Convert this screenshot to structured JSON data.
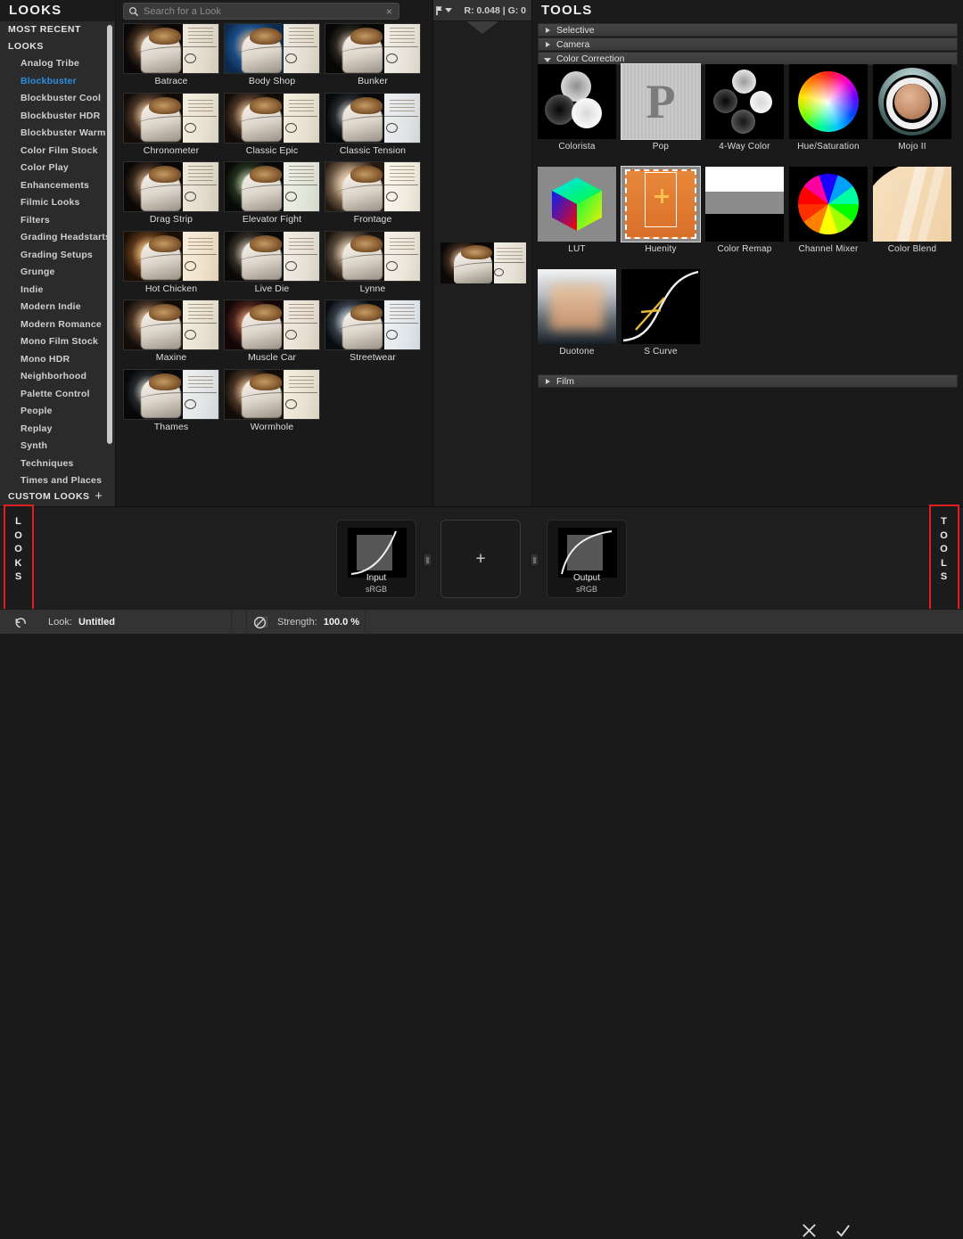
{
  "sidebar": {
    "title": "LOOKS",
    "groups": [
      {
        "label": "MOST RECENT"
      },
      {
        "label": "LOOKS"
      }
    ],
    "items": [
      {
        "label": "Analog Tribe",
        "active": false
      },
      {
        "label": "Blockbuster",
        "active": true
      },
      {
        "label": "Blockbuster Cool",
        "active": false
      },
      {
        "label": "Blockbuster HDR",
        "active": false
      },
      {
        "label": "Blockbuster Warm",
        "active": false
      },
      {
        "label": "Color Film Stock",
        "active": false
      },
      {
        "label": "Color Play",
        "active": false
      },
      {
        "label": "Enhancements",
        "active": false
      },
      {
        "label": "Filmic Looks",
        "active": false
      },
      {
        "label": "Filters",
        "active": false
      },
      {
        "label": "Grading Headstarts",
        "active": false
      },
      {
        "label": "Grading Setups",
        "active": false
      },
      {
        "label": "Grunge",
        "active": false
      },
      {
        "label": "Indie",
        "active": false
      },
      {
        "label": "Modern Indie",
        "active": false
      },
      {
        "label": "Modern Romance",
        "active": false
      },
      {
        "label": "Mono Film Stock",
        "active": false
      },
      {
        "label": "Mono HDR",
        "active": false
      },
      {
        "label": "Neighborhood",
        "active": false
      },
      {
        "label": "Palette Control",
        "active": false
      },
      {
        "label": "People",
        "active": false
      },
      {
        "label": "Replay",
        "active": false
      },
      {
        "label": "Synth",
        "active": false
      },
      {
        "label": "Techniques",
        "active": false
      },
      {
        "label": "Times and Places",
        "active": false
      }
    ],
    "custom_looks_label": "CUSTOM LOOKS",
    "custom_looks_add": "+"
  },
  "search": {
    "placeholder": "Search for a Look",
    "value": "",
    "clear_glyph": "×",
    "icon": "search-icon",
    "import_icon": "import-look-icon"
  },
  "looks": [
    {
      "name": "Batrace",
      "tone": "warm-dark"
    },
    {
      "name": "Body Shop",
      "tone": "blue"
    },
    {
      "name": "Bunker",
      "tone": "neutral-dark"
    },
    {
      "name": "Chronometer",
      "tone": "warm"
    },
    {
      "name": "Classic Epic",
      "tone": "warm"
    },
    {
      "name": "Classic Tension",
      "tone": "cool-dark"
    },
    {
      "name": "Drag Strip",
      "tone": "warm-dark"
    },
    {
      "name": "Elevator Fight",
      "tone": "green"
    },
    {
      "name": "Frontage",
      "tone": "bright"
    },
    {
      "name": "Hot Chicken",
      "tone": "hot"
    },
    {
      "name": "Live Die",
      "tone": "neutral"
    },
    {
      "name": "Lynne",
      "tone": "soft"
    },
    {
      "name": "Maxine",
      "tone": "warm"
    },
    {
      "name": "Muscle Car",
      "tone": "red"
    },
    {
      "name": "Streetwear",
      "tone": "cool"
    },
    {
      "name": "Thames",
      "tone": "cool-dark"
    },
    {
      "name": "Wormhole",
      "tone": "warm"
    }
  ],
  "viewer": {
    "readout": "R: 0.048 | G: 0",
    "flag_icon": "flag-icon",
    "dropdown_icon": "chevron-down-icon"
  },
  "tools": {
    "title": "TOOLS",
    "sections": [
      {
        "label": "Selective",
        "expanded": false
      },
      {
        "label": "Camera",
        "expanded": false
      },
      {
        "label": "Color Correction",
        "expanded": true
      }
    ],
    "footer_section": {
      "label": "Film",
      "expanded": false
    },
    "items": [
      {
        "label": "Colorista",
        "icon": "colorista-balls-icon",
        "selected": false
      },
      {
        "label": "Pop",
        "icon": "pop-p-icon",
        "selected": true
      },
      {
        "label": "4-Way Color",
        "icon": "four-way-color-icon",
        "selected": false
      },
      {
        "label": "Hue/Saturation",
        "icon": "hue-saturation-icon",
        "selected": false
      },
      {
        "label": "Mojo II",
        "icon": "mojo-ring-icon",
        "selected": false
      },
      {
        "label": "LUT",
        "icon": "lut-cube-icon",
        "selected": false
      },
      {
        "label": "Huenity",
        "icon": "huenity-crop-icon",
        "selected": true
      },
      {
        "label": "Color Remap",
        "icon": "color-remap-bars-icon",
        "selected": false
      },
      {
        "label": "Channel Mixer",
        "icon": "channel-mixer-wheel-icon",
        "selected": false
      },
      {
        "label": "Color Blend",
        "icon": "color-blend-icon",
        "selected": false
      },
      {
        "label": "Duotone",
        "icon": "duotone-gradient-icon",
        "selected": false
      },
      {
        "label": "S Curve",
        "icon": "s-curve-icon",
        "selected": false
      }
    ]
  },
  "nodes": [
    {
      "label": "Input",
      "sub": "sRGB",
      "type": "io"
    },
    {
      "label": "+",
      "sub": "",
      "type": "add"
    },
    {
      "label": "Output",
      "sub": "sRGB",
      "type": "io"
    }
  ],
  "panel_tabs": {
    "left": "LOOKS",
    "right": "TOOLS",
    "highlight_color": "#e02020"
  },
  "statusbar": {
    "look_label": "Look:",
    "look_value": "Untitled",
    "strength_label": "Strength:",
    "strength_value": "100.0 %",
    "reset_icon": "reset-arrow-icon",
    "disable_icon": "no-sign-icon",
    "cancel_icon": "cancel-x-icon",
    "accept_icon": "accept-check-icon"
  }
}
